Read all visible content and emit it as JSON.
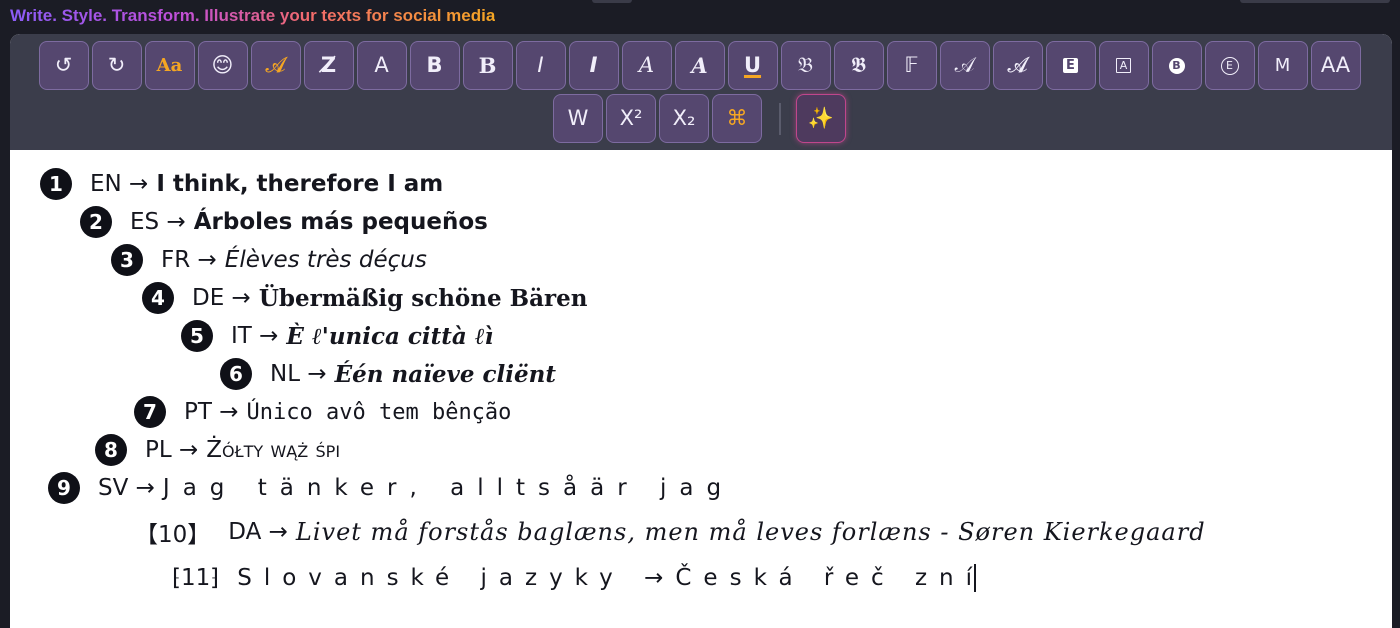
{
  "header": {
    "tagline": "Write. Style. Transform. Illustrate your texts for social media"
  },
  "toolbar": {
    "row1": [
      {
        "name": "undo-button",
        "label": "↺",
        "cls": ""
      },
      {
        "name": "redo-button",
        "label": "↻",
        "cls": ""
      },
      {
        "name": "font-case-button",
        "label": "Aa",
        "cls": "orange serif bold small"
      },
      {
        "name": "emoji-button",
        "label": "😊",
        "cls": ""
      },
      {
        "name": "script-font-button",
        "label": "𝓐",
        "cls": "orange"
      },
      {
        "name": "strikethrough-z-button",
        "label": "Z̸",
        "cls": "bold"
      },
      {
        "name": "sans-a-button",
        "label": "A",
        "cls": ""
      },
      {
        "name": "bold-b-button",
        "label": "B",
        "cls": "bold"
      },
      {
        "name": "bold-serif-b-button",
        "label": "B",
        "cls": "bold serif"
      },
      {
        "name": "italic-i-button",
        "label": "I",
        "cls": "ital"
      },
      {
        "name": "bold-italic-i-button",
        "label": "I",
        "cls": "ital bold"
      },
      {
        "name": "italic-serif-a-button",
        "label": "A",
        "cls": "ital serif"
      },
      {
        "name": "bold-italic-serif-a-button",
        "label": "A",
        "cls": "ital bold serif"
      },
      {
        "name": "underline-button",
        "label": "U",
        "cls": "under"
      },
      {
        "name": "fraktur-button",
        "label": "𝔅",
        "cls": ""
      },
      {
        "name": "bold-fraktur-button",
        "label": "𝕭",
        "cls": ""
      },
      {
        "name": "double-struck-button",
        "label": "𝔽",
        "cls": ""
      },
      {
        "name": "script-a-button",
        "label": "𝒜",
        "cls": ""
      },
      {
        "name": "bold-script-a-button",
        "label": "𝓐",
        "cls": ""
      },
      {
        "name": "boxed-fill-e-button",
        "label": "E",
        "cls": "box"
      },
      {
        "name": "boxed-outline-a-button",
        "label": "A",
        "cls": "boxo"
      },
      {
        "name": "circled-fill-b-button",
        "label": "B",
        "cls": "cfill"
      },
      {
        "name": "circled-outline-e-button",
        "label": "E",
        "cls": "cout"
      },
      {
        "name": "monospace-m-button",
        "label": "M",
        "cls": "small"
      },
      {
        "name": "uppercase-aa-button",
        "label": "AA",
        "cls": ""
      }
    ],
    "row2": [
      {
        "name": "wide-w-button",
        "label": "W",
        "cls": ""
      },
      {
        "name": "superscript-button",
        "label": "X²",
        "cls": ""
      },
      {
        "name": "subscript-button",
        "label": "X₂",
        "cls": ""
      },
      {
        "name": "command-button",
        "label": "⌘",
        "cls": "orange"
      }
    ],
    "magic": {
      "name": "magic-sparkle-button",
      "label": "✨"
    }
  },
  "editor": {
    "lines": [
      {
        "num": "1",
        "lang": "EN →",
        "text": "I think, therefore I am"
      },
      {
        "num": "2",
        "lang": "ES →",
        "text": "Árboles más pequeños"
      },
      {
        "num": "3",
        "lang": "FR →",
        "text": "Élèves très déçus"
      },
      {
        "num": "4",
        "lang": "DE →",
        "text": "Übermäßig schöne Bären"
      },
      {
        "num": "5",
        "lang": "IT →",
        "text": "È ℓ'unica città ℓì"
      },
      {
        "num": "6",
        "lang": "NL →",
        "text": "Één naïeve cliënt"
      },
      {
        "num": "7",
        "lang": "PT →",
        "text": "Único avô tem bênção"
      },
      {
        "num": "8",
        "lang": "PL →",
        "text": "Żółty wąż śpi"
      },
      {
        "num": "9",
        "lang": "SV →",
        "text": "Jag tänker, alltsåär jag"
      }
    ],
    "line10": {
      "bracket": "【10】",
      "lang": "DA →",
      "text": "Livet må forstås baglæns, men må leves forlæns - Søren Kierkegaard"
    },
    "line11": {
      "bracket": "⁅11⁆",
      "lang": "Slovanské jazyky →",
      "text": "Česká řeč zní"
    }
  }
}
